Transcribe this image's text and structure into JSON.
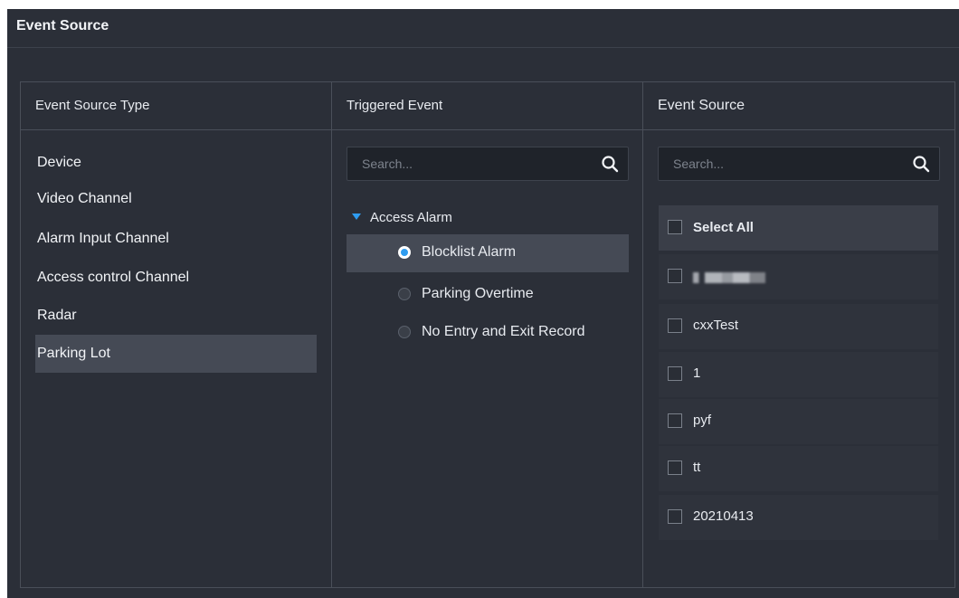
{
  "panel": {
    "title": "Event Source"
  },
  "columns": {
    "source_type": {
      "title": "Event Source Type",
      "items": [
        {
          "label": "Device",
          "selected": false
        },
        {
          "label": "Video Channel",
          "selected": false
        },
        {
          "label": "Alarm Input Channel",
          "selected": false
        },
        {
          "label": "Access control Channel",
          "selected": false
        },
        {
          "label": "Radar",
          "selected": false
        },
        {
          "label": "Parking Lot",
          "selected": true
        }
      ]
    },
    "triggered_event": {
      "title": "Triggered Event",
      "search_placeholder": "Search...",
      "group": {
        "label": "Access Alarm",
        "expanded": true
      },
      "options": [
        {
          "label": "Blocklist Alarm",
          "selected": true
        },
        {
          "label": "Parking Overtime",
          "selected": false
        },
        {
          "label": "No Entry and Exit Record",
          "selected": false
        }
      ]
    },
    "event_source": {
      "title": "Event Source",
      "search_placeholder": "Search...",
      "select_all_label": "Select All",
      "items": [
        {
          "label": "",
          "blurred": true
        },
        {
          "label": "cxxTest"
        },
        {
          "label": "1"
        },
        {
          "label": "pyf"
        },
        {
          "label": "tt"
        },
        {
          "label": "20210413"
        }
      ]
    }
  },
  "icons": {
    "search": "search-icon",
    "expand": "caret-down-icon"
  },
  "colors": {
    "accent": "#2e9cf0",
    "panel_bg": "#2b2f38",
    "selected_bg": "#454a55"
  }
}
